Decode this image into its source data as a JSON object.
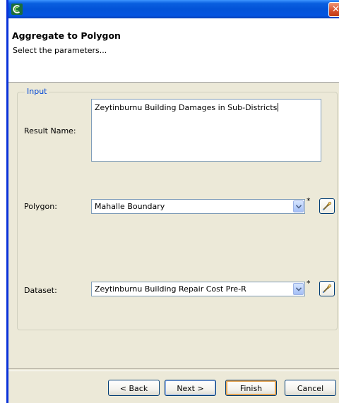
{
  "window": {
    "close_glyph": "✕"
  },
  "header": {
    "title": "Aggregate to Polygon",
    "subtitle": "Select the parameters..."
  },
  "input_group": {
    "legend": "Input",
    "result_name": {
      "label": "Result Name:",
      "value": "Zeytinburnu Building Damages in Sub-Districts"
    },
    "polygon": {
      "label": "Polygon:",
      "selected": "Mahalle Boundary",
      "required_marker": "*"
    },
    "dataset": {
      "label": "Dataset:",
      "selected": "Zeytinburnu Building Repair Cost Pre-R",
      "required_marker": "*"
    }
  },
  "buttons": {
    "back": "< Back",
    "next": "Next >",
    "finish": "Finish",
    "cancel": "Cancel"
  },
  "icons": {
    "app": "app-logo-icon",
    "close": "close-icon",
    "dropdown": "chevron-down-icon",
    "pick": "dropper-icon"
  },
  "colors": {
    "titlebar": "#0353d8",
    "close": "#d8532f",
    "legend_text": "#0046d5",
    "dialog_bg": "#ece9d8"
  }
}
